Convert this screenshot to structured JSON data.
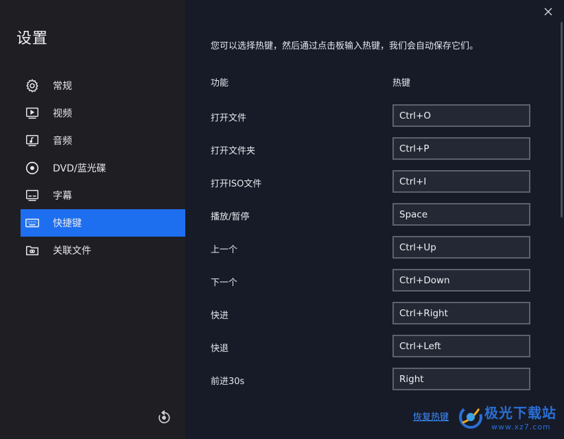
{
  "sidebar": {
    "title": "设置",
    "items": [
      {
        "label": "常规",
        "icon": "gear-icon"
      },
      {
        "label": "视频",
        "icon": "video-icon"
      },
      {
        "label": "音频",
        "icon": "audio-icon"
      },
      {
        "label": "DVD/蓝光碟",
        "icon": "disc-icon"
      },
      {
        "label": "字幕",
        "icon": "subtitle-icon"
      },
      {
        "label": "快捷键",
        "icon": "keyboard-icon",
        "active": true
      },
      {
        "label": "关联文件",
        "icon": "folder-link-icon"
      }
    ]
  },
  "main": {
    "intro": "您可以选择热键，然后通过点击板输入热键，我们会自动保存它们。",
    "col_function": "功能",
    "col_hotkey": "热键",
    "rows": [
      {
        "label": "打开文件",
        "key": "Ctrl+O"
      },
      {
        "label": "打开文件夹",
        "key": "Ctrl+P"
      },
      {
        "label": "打开ISO文件",
        "key": "Ctrl+I"
      },
      {
        "label": "播放/暂停",
        "key": "Space"
      },
      {
        "label": "上一个",
        "key": "Ctrl+Up"
      },
      {
        "label": "下一个",
        "key": "Ctrl+Down"
      },
      {
        "label": "快进",
        "key": "Ctrl+Right"
      },
      {
        "label": "快退",
        "key": "Ctrl+Left"
      },
      {
        "label": "前进30s",
        "key": "Right"
      }
    ],
    "restore_label": "恢复热键"
  },
  "watermark": {
    "name": "极光下载站",
    "url": "www.xz7.com"
  },
  "colors": {
    "accent": "#1e6ff0",
    "sidebar_bg": "#1f1f23",
    "main_bg": "#161b27",
    "link": "#3d8cff"
  }
}
